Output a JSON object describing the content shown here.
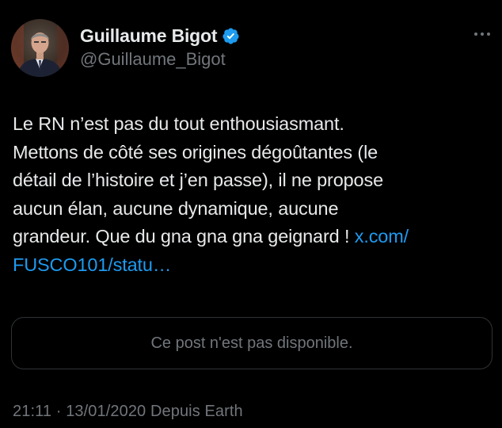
{
  "author": {
    "display_name": "Guillaume Bigot",
    "handle": "@Guillaume_Bigot",
    "verified": true,
    "verified_color": "#1d9bf0"
  },
  "tweet": {
    "text": "Le RN n’est pas du tout enthousiasmant.\nMettons de côté ses origines dégoûtantes (le\ndétail de l’histoire et j’en passe), il ne propose\naucun élan, aucune dynamique, aucune\ngrandeur. Que du gna gna gna geignard ! ",
    "link": "x.com/\nFUSCO101/statu…",
    "link_color": "#1d9bf0"
  },
  "quote": {
    "unavailable_text": "Ce post n'est pas disponible."
  },
  "meta": {
    "time": "21:11",
    "separator": "·",
    "date": "13/01/2020",
    "source": "Depuis Earth"
  },
  "icons": {
    "more": "more-horizontal-icon",
    "verified": "verified-badge-icon"
  },
  "colors": {
    "background": "#000000",
    "text_primary": "#e7e9ea",
    "text_secondary": "#71767b",
    "border": "#2f3336"
  }
}
